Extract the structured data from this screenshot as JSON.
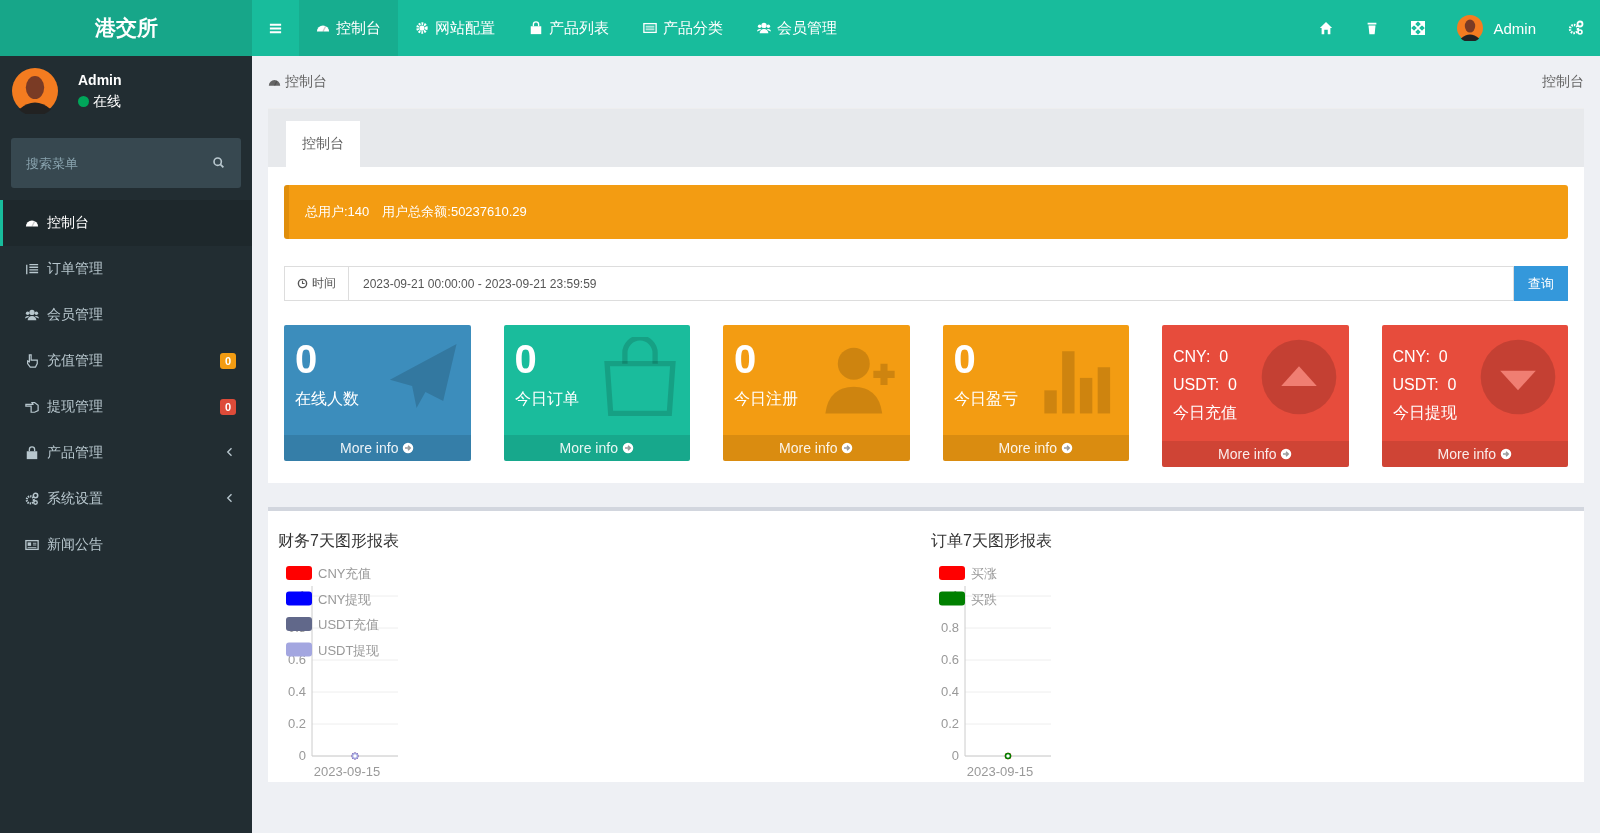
{
  "brand": "港交所",
  "user": {
    "name": "Admin",
    "status": "在线",
    "online": true
  },
  "search": {
    "placeholder": "搜索菜单"
  },
  "sidebar": {
    "items": [
      {
        "label": "控制台",
        "selected": true
      },
      {
        "label": "订单管理",
        "selected": false
      },
      {
        "label": "会员管理",
        "selected": false
      },
      {
        "label": "充值管理",
        "selected": false,
        "badge": "0",
        "color": "#f39c12"
      },
      {
        "label": "提现管理",
        "selected": false,
        "badge": "0",
        "color": "#dd4b39"
      },
      {
        "label": "产品管理",
        "selected": false,
        "expanded": false
      },
      {
        "label": "系统设置",
        "selected": false,
        "expanded": false
      },
      {
        "label": "新闻公告",
        "selected": false
      }
    ]
  },
  "topnav": {
    "items": [
      {
        "label": "控制台",
        "selected": true
      },
      {
        "label": "网站配置",
        "selected": false
      },
      {
        "label": "产品列表",
        "selected": false
      },
      {
        "label": "产品分类",
        "selected": false
      },
      {
        "label": "会员管理",
        "selected": false
      }
    ],
    "user_name": "Admin"
  },
  "breadcrumb": {
    "current": "控制台",
    "right": "控制台"
  },
  "tabs": [
    {
      "label": "控制台",
      "selected": true
    }
  ],
  "alert": {
    "text": "总用户:140　用户总余额:50237610.29"
  },
  "date_filter": {
    "label": "时间",
    "value": "2023-09-21 00:00:00 - 2023-09-21 23:59:59",
    "button": "查询"
  },
  "stats": [
    {
      "kind": "simple",
      "value": "0",
      "label": "在线人数",
      "color": "#3c8dbc",
      "link": "More info"
    },
    {
      "kind": "simple",
      "value": "0",
      "label": "今日订单",
      "color": "#1abc9c",
      "link": "More info"
    },
    {
      "kind": "simple",
      "value": "0",
      "label": "今日注册",
      "color": "#f39c12",
      "link": "More info"
    },
    {
      "kind": "simple",
      "value": "0",
      "label": "今日盈亏",
      "color": "#f39c12",
      "link": "More info"
    },
    {
      "kind": "money",
      "cny": "CNY:  0",
      "usdt": "USDT:  0",
      "label": "今日充值",
      "color": "#e74c3c",
      "link": "More info"
    },
    {
      "kind": "money",
      "cny": "CNY:  0",
      "usdt": "USDT:  0",
      "label": "今日提现",
      "color": "#e74c3c",
      "link": "More info"
    }
  ],
  "charts": [
    {
      "title": "财务7天图形报表",
      "chart_data": {
        "type": "line",
        "grid": true,
        "legend": "top-left",
        "categories": [
          "2023-09-15"
        ],
        "ylim": [
          0,
          1
        ],
        "yticks": [
          0,
          0.2,
          0.4,
          0.6,
          0.8,
          1
        ],
        "series": [
          {
            "name": "CNY充值",
            "color": "#ff0000",
            "marker": true,
            "values": [
              0
            ]
          },
          {
            "name": "CNY提现",
            "color": "#0000ff",
            "marker": true,
            "values": [
              0
            ]
          },
          {
            "name": "USDT充值",
            "color": "#61688a",
            "marker": true,
            "values": [
              0
            ]
          },
          {
            "name": "USDT提现",
            "color": "#a3a6e0",
            "marker": true,
            "values": [
              0
            ]
          }
        ]
      }
    },
    {
      "title": "订单7天图形报表",
      "chart_data": {
        "type": "line",
        "grid": true,
        "legend": "top-left",
        "categories": [
          "2023-09-15"
        ],
        "ylim": [
          0,
          1
        ],
        "yticks": [
          0,
          0.2,
          0.4,
          0.6,
          0.8,
          1
        ],
        "series": [
          {
            "name": "买涨",
            "color": "#ff0000",
            "marker": true,
            "values": [
              0
            ]
          },
          {
            "name": "买跌",
            "color": "#008000",
            "marker": true,
            "values": [
              0
            ]
          }
        ]
      }
    }
  ]
}
